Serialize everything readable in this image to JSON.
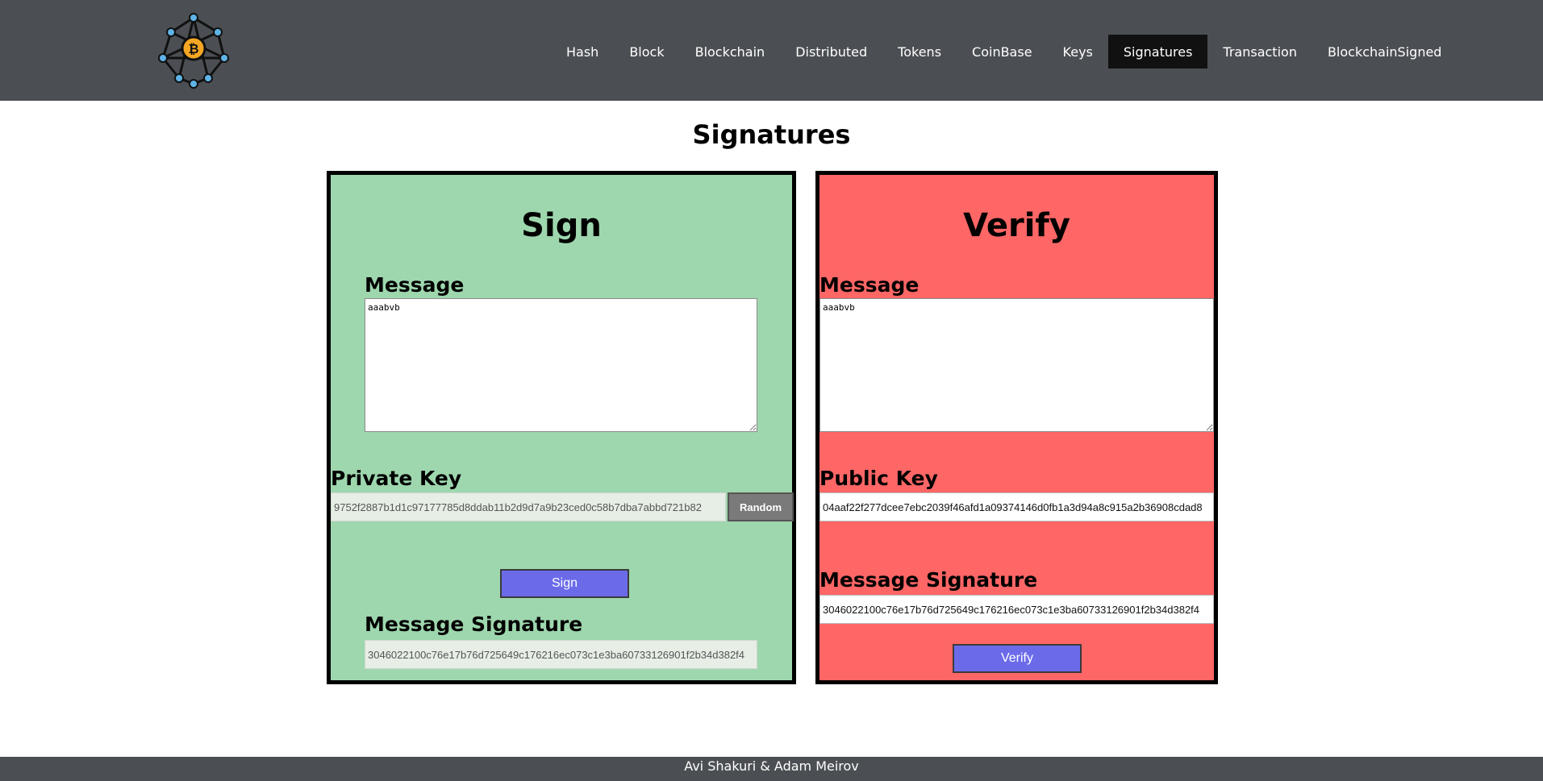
{
  "nav": {
    "links": [
      "Hash",
      "Block",
      "Blockchain",
      "Distributed",
      "Tokens",
      "CoinBase",
      "Keys",
      "Signatures",
      "Transaction",
      "BlockchainSigned"
    ],
    "active": "Signatures"
  },
  "page": {
    "title": "Signatures"
  },
  "sign": {
    "heading": "Sign",
    "message_label": "Message",
    "message_value": "aaabvb",
    "private_key_label": "Private Key",
    "private_key_value": "9752f2887b1d1c97177785d8ddab11b2d9d7a9b23ced0c58b7dba7abbd721b82",
    "random_label": "Random",
    "sign_button": "Sign",
    "signature_label": "Message Signature",
    "signature_value": "3046022100c76e17b76d725649c176216ec073c1e3ba60733126901f2b34d382f4"
  },
  "verify": {
    "heading": "Verify",
    "message_label": "Message",
    "message_value": "aaabvb",
    "public_key_label": "Public Key",
    "public_key_value": "04aaf22f277dcee7ebc2039f46afd1a09374146d0fb1a3d94a8c915a2b36908cdad8",
    "signature_label": "Message Signature",
    "signature_value": "3046022100c76e17b76d725649c176216ec073c1e3ba60733126901f2b34d382f4",
    "verify_button": "Verify"
  },
  "footer": {
    "text": "Avi Shakuri & Adam Meirov"
  },
  "colors": {
    "navbar": "#4b4f53",
    "nav_active": "#111111",
    "sign_panel": "#9ed7ae",
    "verify_panel": "#ff6666",
    "button": "#6b6bea",
    "random_button": "#7a7a7a",
    "logo_accent": "#f5a623"
  },
  "icons": {
    "logo": "bitcoin-network-icon"
  }
}
